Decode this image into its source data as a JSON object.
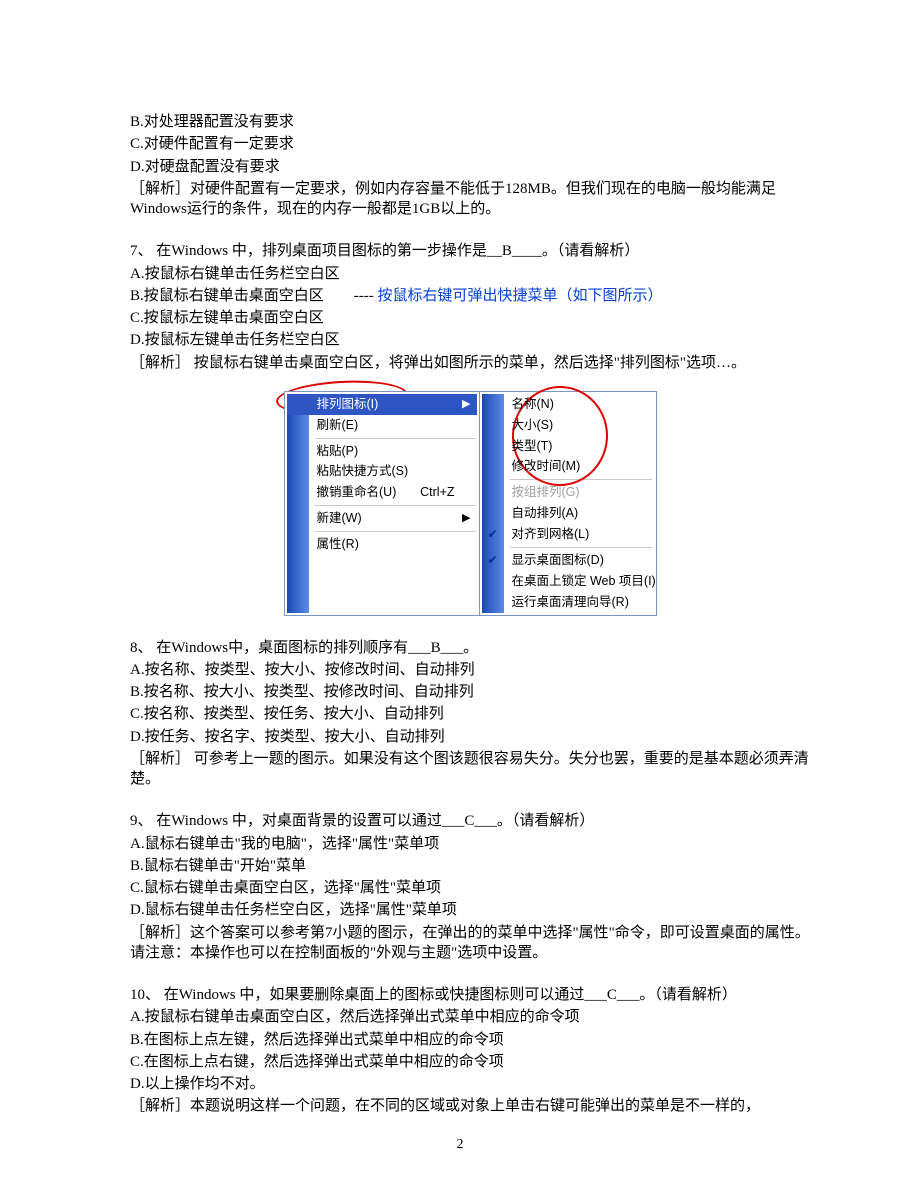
{
  "optB": "B.对处理器配置没有要求",
  "optC": "C.对硬件配置有一定要求",
  "optD": "D.对硬盘配置没有要求",
  "exp1": "［解析］对硬件配置有一定要求，例如内存容量不能低于128MB。但我们现在的电脑一般均能满足Windows运行的条件，现在的内存一般都是1GB以上的。",
  "q7": {
    "stem": "7、 在Windows 中，排列桌面项目图标的第一步操作是__B____。（请看解析）",
    "a": "A.按鼠标右键单击任务栏空白区",
    "b": "B.按鼠标右键单击桌面空白区　　----",
    "bnote": "按鼠标右键可弹出快捷菜单（如下图所示）",
    "c": "C.按鼠标左键单击桌面空白区",
    "d": "D.按鼠标左键单击任务栏空白区",
    "exp": "［解析］ 按鼠标右键单击桌面空白区，将弹出如图所示的菜单，然后选择\"排列图标\"选项…。"
  },
  "menuL": {
    "arrange": "排列图标(I)",
    "refresh": "刷新(E)",
    "paste": "粘贴(P)",
    "pasteSc": "粘贴快捷方式(S)",
    "undo": "撤销重命名(U)",
    "undoKey": "Ctrl+Z",
    "new": "新建(W)",
    "prop": "属性(R)"
  },
  "menuR": {
    "name": "名称(N)",
    "size": "大小(S)",
    "type": "类型(T)",
    "mtime": "修改时间(M)",
    "group": "按组排列(G)",
    "auto": "自动排列(A)",
    "grid": "对齐到网格(L)",
    "show": "显示桌面图标(D)",
    "lock": "在桌面上锁定 Web 项目(I)",
    "wiz": "运行桌面清理向导(R)"
  },
  "q8": {
    "stem": "8、 在Windows中，桌面图标的排列顺序有___B___。",
    "a": "A.按名称、按类型、按大小、按修改时间、自动排列",
    "b": "B.按名称、按大小、按类型、按修改时间、自动排列",
    "c": "C.按名称、按类型、按任务、按大小、自动排列",
    "d": "D.按任务、按名字、按类型、按大小、自动排列",
    "exp": "［解析］ 可参考上一题的图示。如果没有这个图该题很容易失分。失分也罢，重要的是基本题必须弄清楚。"
  },
  "q9": {
    "stem": "9、 在Windows 中，对桌面背景的设置可以通过___C___。（请看解析）",
    "a": "A.鼠标右键单击\"我的电脑\"，选择\"属性\"菜单项",
    "b": "B.鼠标右键单击\"开始\"菜单",
    "c": "C.鼠标右键单击桌面空白区，选择\"属性\"菜单项",
    "d": "D.鼠标右键单击任务栏空白区，选择\"属性\"菜单项",
    "exp": "［解析］这个答案可以参考第7小题的图示，在弹出的的菜单中选择\"属性\"命令，即可设置桌面的属性。请注意：本操作也可以在控制面板的\"外观与主题\"选项中设置。"
  },
  "q10": {
    "stem": "10、 在Windows 中，如果要删除桌面上的图标或快捷图标则可以通过___C___。（请看解析）",
    "a": "A.按鼠标右键单击桌面空白区，然后选择弹出式菜单中相应的命令项",
    "b": "B.在图标上点左键，然后选择弹出式菜单中相应的命令项",
    "c": "C.在图标上点右键，然后选择弹出式菜单中相应的命令项",
    "d": "D.以上操作均不对。",
    "exp": "［解析］本题说明这样一个问题，在不同的区域或对象上单击右键可能弹出的菜单是不一样的，"
  },
  "pagenum": "2"
}
